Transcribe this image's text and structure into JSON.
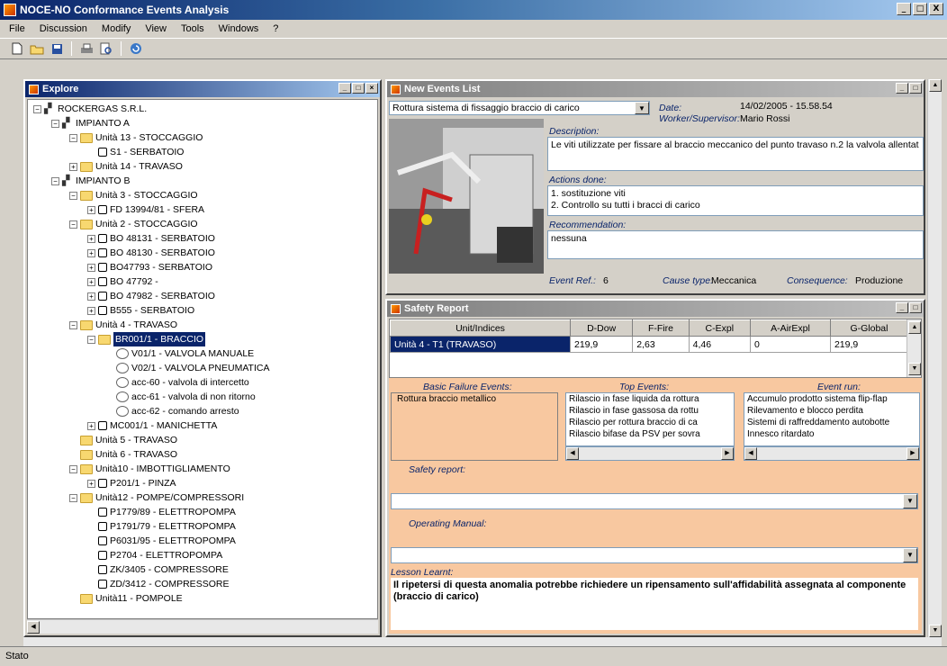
{
  "app": {
    "title": "NOCE-NO Conformance Events Analysis",
    "window_buttons": [
      "_",
      "□",
      "X"
    ]
  },
  "menu": [
    "File",
    "Discussion",
    "Modify",
    "View",
    "Tools",
    "Windows",
    "?"
  ],
  "toolbar": [
    "new-icon",
    "open-icon",
    "save-icon",
    "print-icon",
    "print-preview-icon",
    "refresh-icon"
  ],
  "explore": {
    "title": "Explore",
    "tree": [
      {
        "label": "ROCKERGAS S.R.L.",
        "type": "plant",
        "exp": "−",
        "level": 0
      },
      {
        "label": "IMPIANTO A",
        "type": "plant",
        "exp": "−",
        "level": 1
      },
      {
        "label": "Unità 13 - STOCCAGGIO",
        "type": "folder",
        "exp": "−",
        "level": 2
      },
      {
        "label": "S1 - SERBATOIO",
        "type": "box",
        "exp": "",
        "level": 3
      },
      {
        "label": "Unità 14 - TRAVASO",
        "type": "folder",
        "exp": "+",
        "level": 2
      },
      {
        "label": "IMPIANTO B",
        "type": "plant",
        "exp": "−",
        "level": 1
      },
      {
        "label": "Unità 3 - STOCCAGGIO",
        "type": "folder",
        "exp": "−",
        "level": 2
      },
      {
        "label": "FD 13994/81 - SFERA",
        "type": "box",
        "exp": "+",
        "level": 3
      },
      {
        "label": "Unità 2 - STOCCAGGIO",
        "type": "folder",
        "exp": "−",
        "level": 2
      },
      {
        "label": "BO 48131 - SERBATOIO",
        "type": "box",
        "exp": "+",
        "level": 3
      },
      {
        "label": "BO 48130 - SERBATOIO",
        "type": "box",
        "exp": "+",
        "level": 3
      },
      {
        "label": "BO47793 - SERBATOIO",
        "type": "box",
        "exp": "+",
        "level": 3
      },
      {
        "label": "BO 47792 -",
        "type": "box",
        "exp": "+",
        "level": 3
      },
      {
        "label": "BO 47982 - SERBATOIO",
        "type": "box",
        "exp": "+",
        "level": 3
      },
      {
        "label": "B555 - SERBATOIO",
        "type": "box",
        "exp": "+",
        "level": 3
      },
      {
        "label": "Unità 4 - TRAVASO",
        "type": "folder",
        "exp": "−",
        "level": 2
      },
      {
        "label": "BR001/1 - BRACCIO",
        "type": "folder",
        "exp": "−",
        "level": 3,
        "selected": true
      },
      {
        "label": "V01/1 - VALVOLA MANUALE",
        "type": "valve",
        "exp": "",
        "level": 4
      },
      {
        "label": "V02/1 - VALVOLA PNEUMATICA",
        "type": "valve",
        "exp": "",
        "level": 4
      },
      {
        "label": "acc-60 - valvola di intercetto",
        "type": "valve",
        "exp": "",
        "level": 4
      },
      {
        "label": "acc-61 - valvola di non ritorno",
        "type": "valve",
        "exp": "",
        "level": 4
      },
      {
        "label": "acc-62 - comando arresto",
        "type": "valve",
        "exp": "",
        "level": 4
      },
      {
        "label": "MC001/1 - MANICHETTA",
        "type": "box",
        "exp": "+",
        "level": 3
      },
      {
        "label": "Unità 5 - TRAVASO",
        "type": "folder",
        "exp": "",
        "level": 2
      },
      {
        "label": "Unità 6 - TRAVASO",
        "type": "folder",
        "exp": "",
        "level": 2
      },
      {
        "label": "Unità10 - IMBOTTIGLIAMENTO",
        "type": "folder",
        "exp": "−",
        "level": 2
      },
      {
        "label": "P201/1 - PINZA",
        "type": "box",
        "exp": "+",
        "level": 3
      },
      {
        "label": "Unità12 - POMPE/COMPRESSORI",
        "type": "folder",
        "exp": "−",
        "level": 2
      },
      {
        "label": "P1779/89 - ELETTROPOMPA",
        "type": "box",
        "exp": "",
        "level": 3
      },
      {
        "label": "P1791/79 - ELETTROPOMPA",
        "type": "box",
        "exp": "",
        "level": 3
      },
      {
        "label": "P6031/95 - ELETTROPOMPA",
        "type": "box",
        "exp": "",
        "level": 3
      },
      {
        "label": "P2704 - ELETTROPOMPA",
        "type": "box",
        "exp": "",
        "level": 3
      },
      {
        "label": "ZK/3405 - COMPRESSORE",
        "type": "box",
        "exp": "",
        "level": 3
      },
      {
        "label": "ZD/3412 - COMPRESSORE",
        "type": "box",
        "exp": "",
        "level": 3
      },
      {
        "label": "Unità11 - POMPOLE",
        "type": "folder",
        "exp": "",
        "level": 2
      }
    ]
  },
  "events": {
    "title": "New Events List",
    "event_select": "Rottura sistema di fissaggio braccio di carico",
    "date_label": "Date:",
    "date_value": "14/02/2005 - 15.58.54",
    "worker_label": "Worker/Supervisor:",
    "worker_value": "Mario Rossi",
    "description_label": "Description:",
    "description": "Le viti utilizzate per fissare al braccio meccanico del punto travaso n.2 la valvola allentat",
    "actions_label": "Actions done:",
    "actions": [
      "1. sostituzione viti",
      "2. Controllo su tutti i bracci di carico"
    ],
    "recommendation_label": "Recommendation:",
    "recommendation": "nessuna",
    "eventref_label": "Event Ref.:",
    "eventref_value": "6",
    "cause_label": "Cause type:",
    "cause_value": "Meccanica",
    "consequence_label": "Consequence:",
    "consequence_value": "Produzione"
  },
  "safety": {
    "title": "Safety Report",
    "columns": [
      "Unit/Indices",
      "D-Dow",
      "F-Fire",
      "C-Expl",
      "A-AirExpl",
      "G-Global"
    ],
    "row": [
      "Unità 4 - T1 (TRAVASO)",
      "219,9",
      "2,63",
      "4,46",
      "0",
      "219,9"
    ],
    "basic_label": "Basic Failure Events:",
    "basic_items": [
      "Rottura braccio metallico"
    ],
    "top_label": "Top Events:",
    "top_items": [
      "Rilascio in fase liquida da rottura",
      "Rilascio in fase gassosa da rottu",
      "Rilascio per rottura braccio di ca",
      "Rilascio bifase da PSV per sovra"
    ],
    "eventrun_label": "Event run:",
    "eventrun_items": [
      "Accumulo prodotto sistema flip-flap",
      "Rilevamento e blocco perdita",
      "Sistemi di raffreddamento autobotte",
      "Innesco ritardato"
    ],
    "safetyreport_label": "Safety report:",
    "operating_label": "Operating Manual:",
    "lesson_label": "Lesson Learnt:",
    "lesson": "Il ripetersi di questa anomalia potrebbe richiedere un ripensamento sull'affidabilità assegnata al componente (braccio di carico)"
  },
  "status": "Stato"
}
